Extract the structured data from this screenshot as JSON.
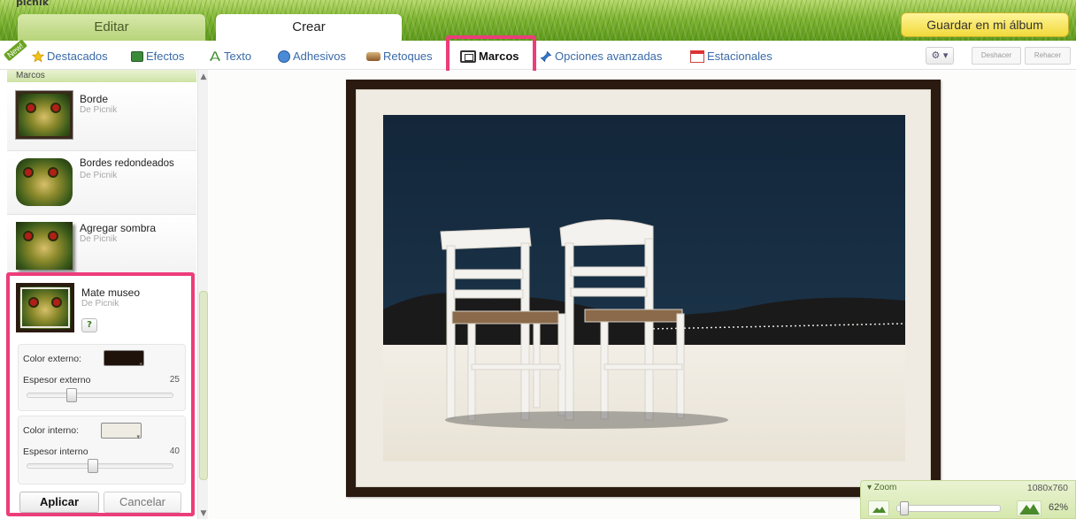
{
  "app": {
    "title_partial": "picnik"
  },
  "header": {
    "tabs": [
      {
        "label": "Editar",
        "active": false
      },
      {
        "label": "Crear",
        "active": true
      }
    ],
    "save_button": "Guardar en mi álbum"
  },
  "toolbar": {
    "new_badge": "New!",
    "items": [
      {
        "label": "Destacados",
        "icon": "star-icon"
      },
      {
        "label": "Efectos",
        "icon": "effects-icon"
      },
      {
        "label": "Texto",
        "icon": "text-icon"
      },
      {
        "label": "Adhesivos",
        "icon": "smiley-icon"
      },
      {
        "label": "Retoques",
        "icon": "retouch-icon"
      },
      {
        "label": "Marcos",
        "icon": "frames-icon",
        "active": true
      },
      {
        "label": "Opciones avanzadas",
        "icon": "pin-icon"
      },
      {
        "label": "Estacionales",
        "icon": "calendar-icon"
      }
    ],
    "gear_label": "⚙ ▾",
    "undo": "Deshacer",
    "redo": "Rehacer"
  },
  "panel": {
    "header": "Marcos",
    "frames": [
      {
        "title": "Borde",
        "source": "De Picnik"
      },
      {
        "title": "Bordes redondeados",
        "source": "De Picnik"
      },
      {
        "title": "Agregar sombra",
        "source": "De Picnik"
      }
    ],
    "selected": {
      "title": "Mate museo",
      "source": "De Picnik",
      "help": "?",
      "outer_color_label": "Color externo:",
      "outer_color": "#1f120a",
      "outer_thickness_label": "Espesor externo",
      "outer_thickness_value": "25",
      "outer_thickness_fraction": 0.29,
      "inner_color_label": "Color interno:",
      "inner_color": "#efece3",
      "inner_thickness_label": "Espesor interno",
      "inner_thickness_value": "40",
      "inner_thickness_fraction": 0.45,
      "apply": "Aplicar",
      "cancel": "Cancelar"
    }
  },
  "zoom": {
    "label": "▾ Zoom",
    "dimensions": "1080x760",
    "percent": "62%"
  },
  "colors": {
    "accent_highlight": "#ec3d7a",
    "frame_outer": "#2a1a10",
    "frame_inner": "#efebe2"
  }
}
